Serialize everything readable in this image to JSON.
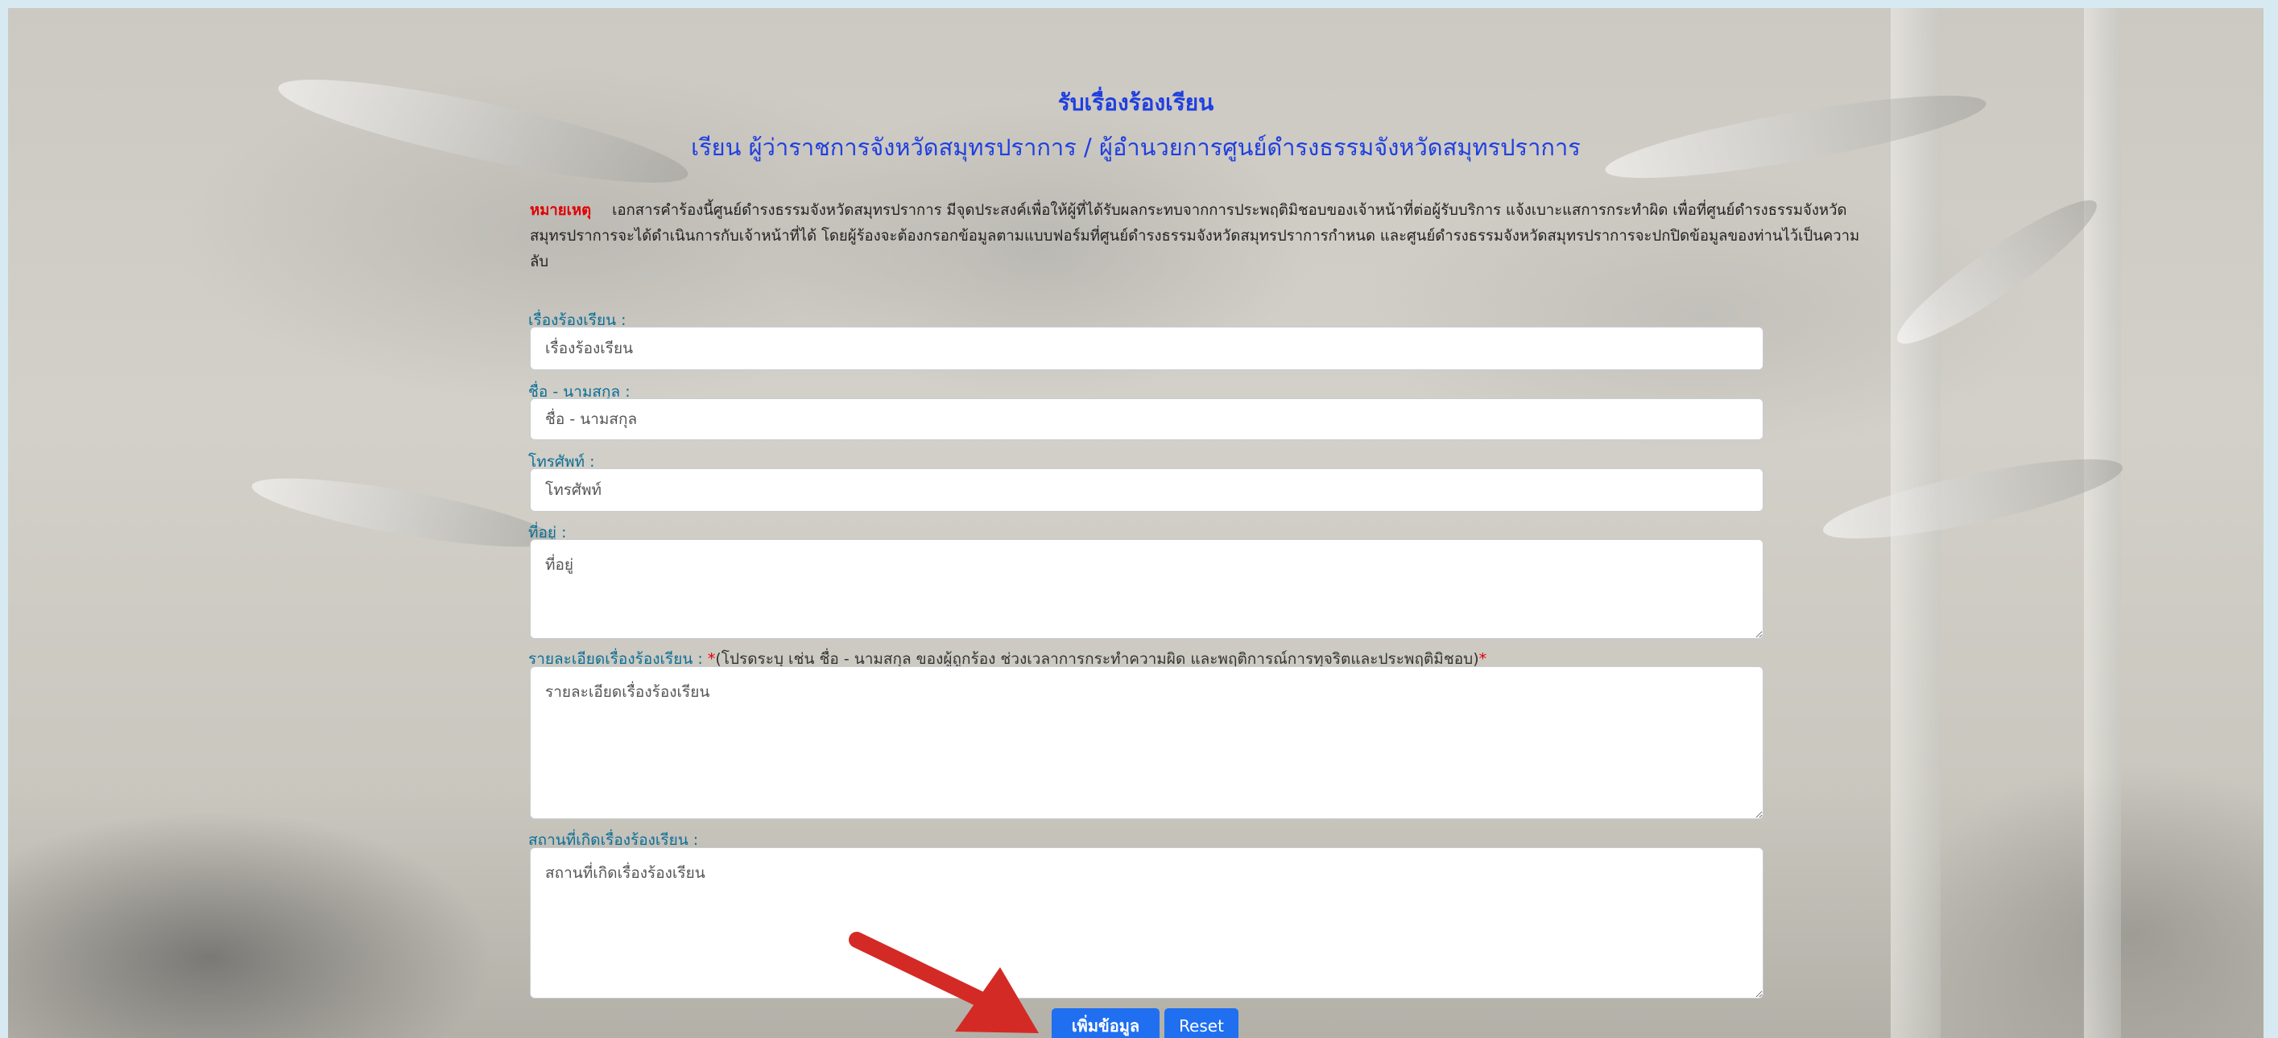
{
  "header": {
    "title": "รับเรื่องร้องเรียน",
    "subtitle": "เรียน ผู้ว่าราชการจังหวัดสมุทรปราการ / ผู้อำนวยการศูนย์ดำรงธรรมจังหวัดสมุทรปราการ"
  },
  "note": {
    "label": "หมายเหตุ",
    "text": "เอกสารคำร้องนี้ศูนย์ดำรงธรรมจังหวัดสมุทรปราการ มีจุดประสงค์เพื่อให้ผู้ที่ได้รับผลกระทบจากการประพฤติมิชอบของเจ้าหน้าที่ต่อผู้รับบริการ แจ้งเบาะแสการกระทำผิด เพื่อที่ศูนย์ดำรงธรรมจังหวัดสมุทรปราการจะได้ดำเนินการกับเจ้าหน้าที่ได้ โดยผู้ร้องจะต้องกรอกข้อมูลตามแบบฟอร์มที่ศูนย์ดำรงธรรมจังหวัดสมุทรปราการกำหนด และศูนย์ดำรงธรรมจังหวัดสมุทรปราการจะปกปิดข้อมูลของท่านไว้เป็นความลับ"
  },
  "form": {
    "subject": {
      "label": "เรื่องร้องเรียน :",
      "placeholder": "เรื่องร้องเรียน"
    },
    "name": {
      "label": "ชื่อ - นามสกุล :",
      "placeholder": "ชื่อ - นามสกุล"
    },
    "phone": {
      "label": "โทรศัพท์ :",
      "placeholder": "โทรศัพท์"
    },
    "address": {
      "label": "ที่อยู่ :",
      "placeholder": "ที่อยู่"
    },
    "details": {
      "label": "รายละเอียดเรื่องร้องเรียน :",
      "required_mark": "*",
      "hint": "(โปรดระบุ เช่น ชื่อ - นามสกุล ของผู้ถูกร้อง ช่วงเวลาการกระทำความผิด และพฤติการณ์การทุจริตและประพฤติมิชอบ)",
      "placeholder": "รายละเอียดเรื่องร้องเรียน"
    },
    "location": {
      "label": "สถานที่เกิดเรื่องร้องเรียน :",
      "placeholder": "สถานที่เกิดเรื่องร้องเรียน"
    },
    "submit_label": "เพิ่มข้อมูล",
    "reset_label": "Reset"
  },
  "colors": {
    "title": "#1f3fe0",
    "label": "#0b6f96",
    "required": "#e00000",
    "button": "#1f6ff0",
    "arrow": "#d42a26"
  }
}
